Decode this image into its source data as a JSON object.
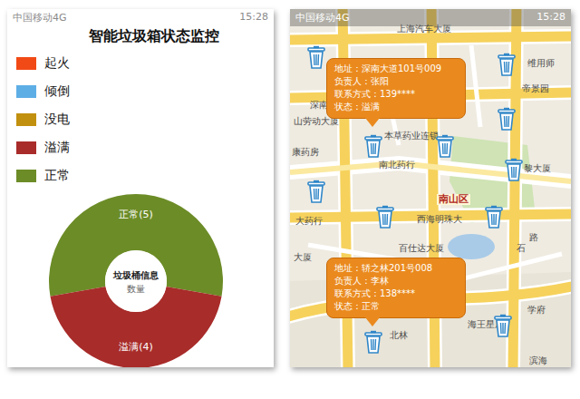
{
  "status_bar": {
    "carrier": "中国移动4G",
    "time": "15:28"
  },
  "dashboard": {
    "title": "智能垃圾箱状态监控",
    "legend": [
      {
        "label": "起火",
        "color": "#f24a16"
      },
      {
        "label": "倾倒",
        "color": "#5eaee6"
      },
      {
        "label": "没电",
        "color": "#c2900f"
      },
      {
        "label": "溢满",
        "color": "#a82c2a"
      },
      {
        "label": "正常",
        "color": "#6c8c27"
      }
    ],
    "chart": {
      "center_title": "垃圾桶信息",
      "center_subtitle": "数量",
      "slices": [
        {
          "label": "正常(5)",
          "value": 5,
          "color": "#6c8c27"
        },
        {
          "label": "溢满(4)",
          "value": 4,
          "color": "#a82c2a"
        }
      ]
    }
  },
  "map": {
    "status_bar": {
      "carrier": "中国移动4G",
      "time": "15:28"
    },
    "labels": [
      "上海汽车大厦",
      "维用师",
      "帝景园",
      "深南大",
      "山劳动大厦",
      "本草药业连锁",
      "康药房",
      "南北药行",
      "南山区",
      "西海明珠大",
      "大药行",
      "黎大厦",
      "百仕达大厦",
      "路",
      "石",
      "学府",
      "海王星辰",
      "北林",
      "滨海",
      "大厦"
    ],
    "callouts": [
      {
        "address": "地址：深南大道101号009",
        "owner": "负责人：张阳",
        "phone": "联系方式：139****",
        "status": "状态：溢满"
      },
      {
        "address": "地址：轿之林201号008",
        "owner": "负责人：李林",
        "phone": "联系方式：138****",
        "status": "状态：正常"
      }
    ],
    "bins": 11
  }
}
